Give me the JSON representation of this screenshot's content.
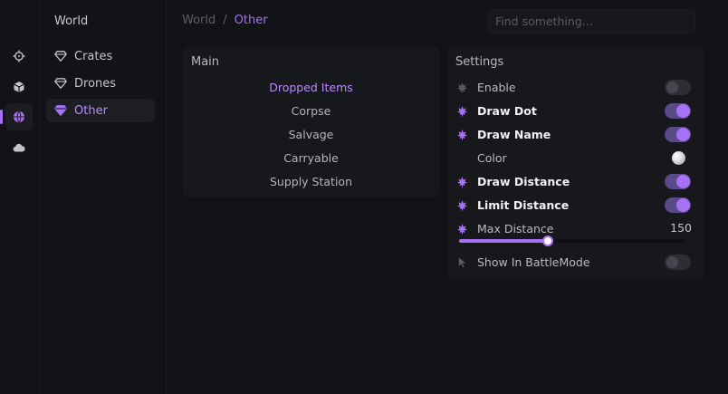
{
  "colors": {
    "accent": "#a771f5",
    "background": "#121316",
    "panel": "#17181c"
  },
  "rail": [
    {
      "icon": "crosshair-icon",
      "active": false
    },
    {
      "icon": "cube-icon",
      "active": false
    },
    {
      "icon": "globe-icon",
      "active": true
    },
    {
      "icon": "cloud-icon",
      "active": false
    }
  ],
  "sidebar": {
    "title": "World",
    "items": [
      {
        "label": "Crates",
        "icon": "gem-icon",
        "active": false
      },
      {
        "label": "Drones",
        "icon": "gem-icon",
        "active": false
      },
      {
        "label": "Other",
        "icon": "gem-icon",
        "active": true
      }
    ]
  },
  "breadcrumb": {
    "root": "World",
    "separator": "/",
    "current": "Other"
  },
  "search": {
    "placeholder": "Find something...",
    "value": ""
  },
  "main": {
    "title": "Main",
    "items": [
      {
        "label": "Dropped Items",
        "active": true
      },
      {
        "label": "Corpse",
        "active": false
      },
      {
        "label": "Salvage",
        "active": false
      },
      {
        "label": "Carryable",
        "active": false
      },
      {
        "label": "Supply Station",
        "active": false
      }
    ]
  },
  "settings": {
    "title": "Settings",
    "rows": [
      {
        "label": "Enable",
        "icon": "leaf-icon",
        "icon_active": false,
        "bold": false,
        "control": "toggle",
        "on": false
      },
      {
        "label": "Draw Dot",
        "icon": "leaf-icon",
        "icon_active": true,
        "bold": true,
        "control": "toggle",
        "on": true
      },
      {
        "label": "Draw Name",
        "icon": "leaf-icon",
        "icon_active": true,
        "bold": true,
        "control": "toggle",
        "on": true
      },
      {
        "label": "Color",
        "icon": "",
        "icon_active": false,
        "bold": false,
        "control": "color",
        "color": "#ffffff"
      },
      {
        "label": "Draw Distance",
        "icon": "leaf-icon",
        "icon_active": true,
        "bold": true,
        "control": "toggle",
        "on": true
      },
      {
        "label": "Limit Distance",
        "icon": "leaf-icon",
        "icon_active": true,
        "bold": true,
        "control": "toggle",
        "on": true
      },
      {
        "label": "Max Distance",
        "icon": "leaf-icon",
        "icon_active": true,
        "bold": false,
        "control": "value",
        "value": "150"
      },
      {
        "label": "Show In BattleMode",
        "icon": "cursor-icon",
        "icon_active": false,
        "bold": false,
        "control": "toggle",
        "on": false
      }
    ],
    "max_distance_slider": {
      "value": 150,
      "fraction": 0.39
    }
  }
}
